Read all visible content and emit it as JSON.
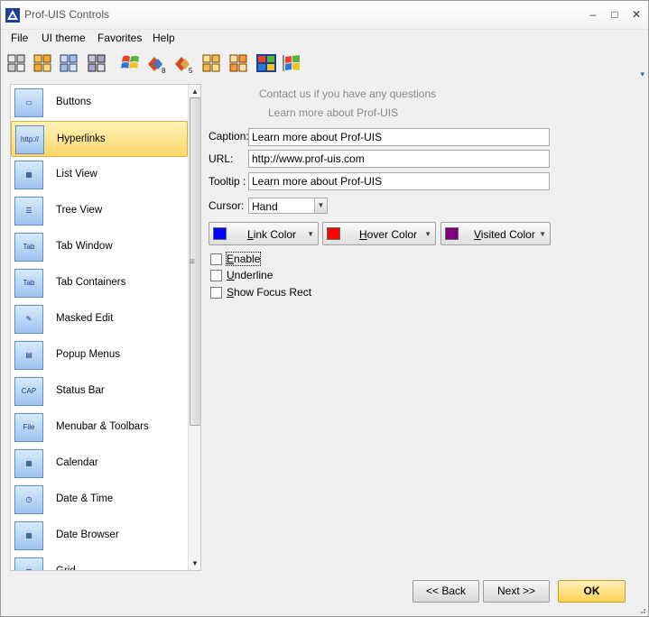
{
  "window": {
    "title": "Prof-UIS Controls",
    "minimize": "–",
    "maximize": "□",
    "close": "✕"
  },
  "menu": [
    "File",
    "UI theme",
    "Favorites",
    "Help"
  ],
  "toolbar": {
    "buttons": [
      {
        "icon": "theme-2000-icon"
      },
      {
        "icon": "theme-xp-icon"
      },
      {
        "icon": "theme-2003-icon"
      },
      {
        "icon": "theme-2005-icon"
      },
      {
        "icon": "theme-windows-xp-icon"
      },
      {
        "icon": "theme-studio-8-icon"
      },
      {
        "icon": "theme-studio-5-icon"
      },
      {
        "icon": "theme-office-2007-icon"
      },
      {
        "icon": "theme-office-2007-alt-icon"
      },
      {
        "icon": "theme-native-icon"
      },
      {
        "icon": "theme-windows-classic-icon"
      }
    ],
    "overflow": "▾"
  },
  "list": {
    "items": [
      {
        "label": "Buttons",
        "icon": "buttons-icon"
      },
      {
        "label": "Hyperlinks",
        "icon": "hyperlinks-icon",
        "selected": true
      },
      {
        "label": "List View",
        "icon": "list-view-icon"
      },
      {
        "label": "Tree View",
        "icon": "tree-view-icon"
      },
      {
        "label": "Tab Window",
        "icon": "tab-window-icon"
      },
      {
        "label": "Tab Containers",
        "icon": "tab-containers-icon"
      },
      {
        "label": "Masked Edit",
        "icon": "masked-edit-icon"
      },
      {
        "label": "Popup Menus",
        "icon": "popup-menus-icon"
      },
      {
        "label": "Status Bar",
        "icon": "status-bar-icon"
      },
      {
        "label": "Menubar & Toolbars",
        "icon": "menubar-toolbars-icon"
      },
      {
        "label": "Calendar",
        "icon": "calendar-icon"
      },
      {
        "label": "Date & Time",
        "icon": "date-time-icon"
      },
      {
        "label": "Date Browser",
        "icon": "date-browser-icon"
      },
      {
        "label": "Grid",
        "icon": "grid-icon"
      }
    ]
  },
  "hyperlinks": {
    "link1": "Contact us if you have any questions",
    "link2": "Learn more about Prof-UIS",
    "caption_label": "Caption:",
    "caption_value": "Learn more about Prof-UIS",
    "url_label": "URL:",
    "url_value": "http://www.prof-uis.com",
    "tooltip_label": "Tooltip :",
    "tooltip_value": "Learn more about Prof-UIS",
    "cursor_label": "Cursor:",
    "cursor_value": "Hand",
    "link_color_label": "Link Color",
    "link_color": "#0000ff",
    "hover_color_label": "Hover Color",
    "hover_color": "#ff0000",
    "visited_color_label": "Visited Color",
    "visited_color": "#800080",
    "enable_label": "Enable",
    "underline_label": "Underline",
    "focus_rect_label": "Show Focus Rect"
  },
  "footer": {
    "back": "<< Back",
    "next": "Next >>",
    "ok": "OK"
  }
}
